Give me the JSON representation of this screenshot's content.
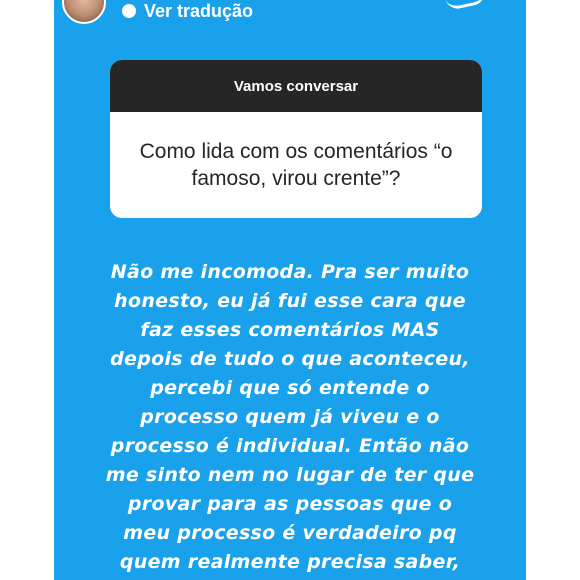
{
  "header": {
    "translate_label": "Ver tradução"
  },
  "question_box": {
    "title": "Vamos conversar",
    "question": "Como lida com os comentários “o famoso, virou crente”?"
  },
  "answer_lines": [
    "Não me incomoda. Pra ser muito",
    "honesto, eu já fui esse cara que",
    "faz esses comentários MAS",
    "depois de tudo o que aconteceu,",
    "percebi que só entende o",
    "processo quem já viveu e o",
    "processo é individual. Então não",
    "me sinto nem no lugar de ter que",
    "provar para as pessoas que o",
    "meu processo é verdadeiro pq",
    "quem realmente precisa saber,"
  ],
  "colors": {
    "story_background": "#1aa1ec",
    "question_header": "#262626",
    "text_light": "#ffffff"
  }
}
